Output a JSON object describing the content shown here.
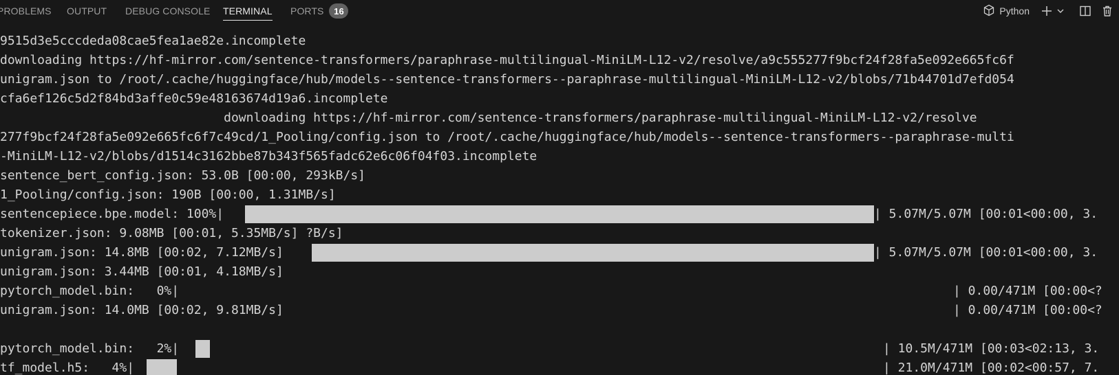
{
  "panel": {
    "tabs": [
      {
        "label": "PROBLEMS"
      },
      {
        "label": "OUTPUT"
      },
      {
        "label": "DEBUG CONSOLE"
      },
      {
        "label": "TERMINAL"
      },
      {
        "label": "PORTS",
        "badge": "16"
      }
    ],
    "profile_label": "Python",
    "icons": [
      "terminal-profile-icon",
      "add-icon",
      "chevron-down-icon",
      "split-editor-icon",
      "trash-icon"
    ]
  },
  "terminal": {
    "lines": [
      "9515d3e5cccdeda08cae5fea1ae82e.incomplete",
      "downloading https://hf-mirror.com/sentence-transformers/paraphrase-multilingual-MiniLM-L12-v2/resolve/a9c555277f9bcf24f28fa5e092e665fc6f",
      "unigram.json to /root/.cache/huggingface/hub/models--sentence-transformers--paraphrase-multilingual-MiniLM-L12-v2/blobs/71b44701d7efd054",
      "cfa6ef126c5d2f84bd3affe0c59e48163674d19a6.incomplete",
      "                              downloading https://hf-mirror.com/sentence-transformers/paraphrase-multilingual-MiniLM-L12-v2/resolve",
      "277f9bcf24f28fa5e092e665fc6f7c49cd/1_Pooling/config.json to /root/.cache/huggingface/hub/models--sentence-transformers--paraphrase-multi",
      "-MiniLM-L12-v2/blobs/d1514c3162bbe87b343f565fadc62e6c06f04f03.incomplete",
      "sentence_bert_config.json: 53.0B [00:00, 293kB/s]",
      "1_Pooling/config.json: 190B [00:00, 1.31MB/s]"
    ],
    "progress_rows": [
      {
        "prefix": "sentencepiece.bpe.model: 100%|",
        "percent": 100,
        "suffix": "| 5.07M/5.07M [00:01<00:00, 3."
      },
      {
        "prefix": "tokenizer.json: 9.08MB [00:01, 5.35MB/s] ?B/s]"
      },
      {
        "prefix": "unigram.json: 14.8MB [00:02, 7.12MB/s]",
        "percent": 100,
        "suffix": "| 5.07M/5.07M [00:01<00:00, 3."
      },
      {
        "prefix": "unigram.json: 3.44MB [00:01, 4.18MB/s]"
      },
      {
        "prefix": "pytorch_model.bin:   0%|",
        "percent": 0,
        "suffix": "| 0.00/471M [00:00<?"
      },
      {
        "prefix": "unigram.json: 14.0MB [00:02, 9.81MB/s]",
        "suffix": "| 0.00/471M [00:00<?"
      },
      {
        "prefix": ""
      },
      {
        "prefix": "pytorch_model.bin:   2%|",
        "percent": 2,
        "suffix": "| 10.5M/471M [00:03<02:13, 3."
      },
      {
        "prefix": "tf_model.h5:   4%|",
        "percent": 4,
        "suffix": "| 21.0M/471M [00:02<00:57, 7."
      }
    ]
  },
  "colors": {
    "background": "#181818",
    "text": "#d4d4d4",
    "progress_fill": "#cccccc",
    "badge_bg": "#616161"
  }
}
